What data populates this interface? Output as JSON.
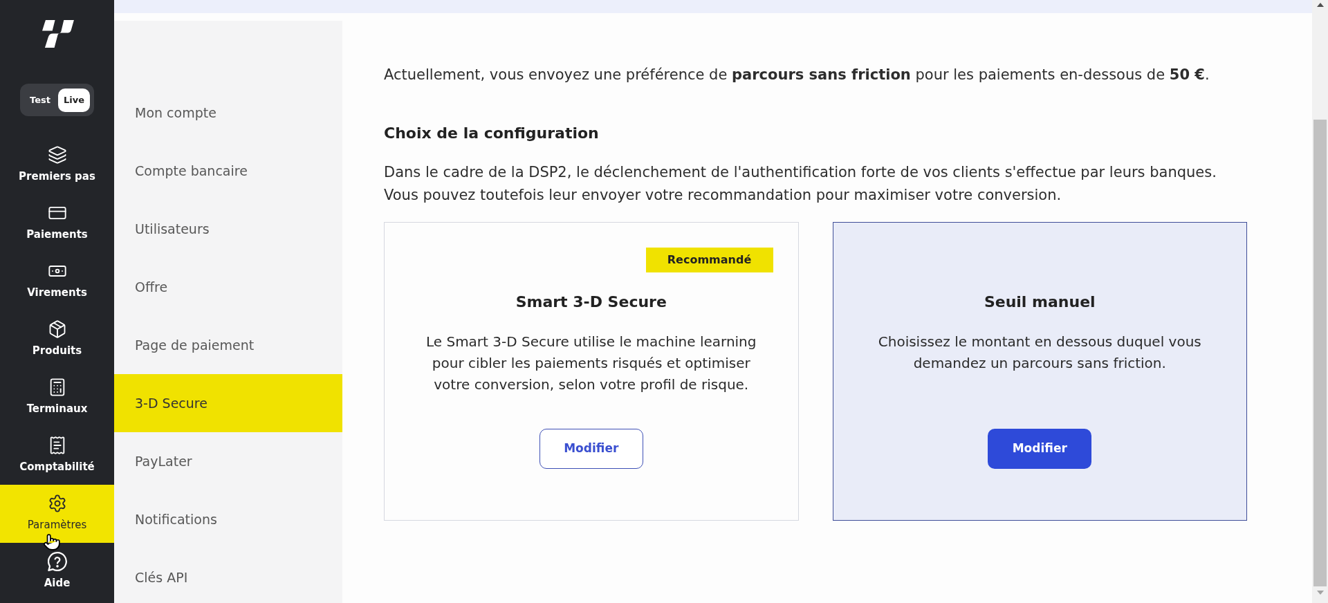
{
  "nav": {
    "mode_toggle": [
      {
        "label": "Test",
        "selected": false
      },
      {
        "label": "Live",
        "selected": true
      }
    ],
    "items": [
      {
        "label": "Premiers pas",
        "selected": false
      },
      {
        "label": "Paiements",
        "selected": false
      },
      {
        "label": "Virements",
        "selected": false
      },
      {
        "label": "Produits",
        "selected": false
      },
      {
        "label": "Terminaux",
        "selected": false
      },
      {
        "label": "Comptabilité",
        "selected": false
      },
      {
        "label": "Paramètres",
        "selected": true
      },
      {
        "label": "Aide",
        "selected": false
      }
    ]
  },
  "settings_menu": {
    "items": [
      {
        "label": "Mon compte",
        "selected": false
      },
      {
        "label": "Compte bancaire",
        "selected": false
      },
      {
        "label": "Utilisateurs",
        "selected": false
      },
      {
        "label": "Offre",
        "selected": false
      },
      {
        "label": "Page de paiement",
        "selected": false
      },
      {
        "label": "3-D Secure",
        "selected": true
      },
      {
        "label": "PayLater",
        "selected": false
      },
      {
        "label": "Notifications",
        "selected": false
      },
      {
        "label": "Clés API",
        "selected": false
      }
    ]
  },
  "content": {
    "summary": "Actuellement, vous envoyez une préférence de **parcours sans friction** pour les paiements en-dessous de **50 €**.",
    "heading": "Choix de la configuration",
    "description": [
      "Dans le cadre de la DSP2, le déclenchement de l'authentification forte de vos clients s'effectue par leurs banques.",
      "Vous pouvez toutefois leur envoyer votre recommandation pour maximiser votre conversion."
    ],
    "options": [
      {
        "badge": "Recommandé",
        "title": "Smart 3-D Secure",
        "description": "Le Smart 3-D Secure utilise le machine learning pour cibler les paiements risqués et optimiser votre conversion, selon votre profil de risque.",
        "button": "Modifier",
        "selected": false
      },
      {
        "title": "Seuil manuel",
        "description": "Choisissez le montant en dessous duquel vous demandez un parcours sans friction.",
        "button": "Modifier",
        "selected": true
      }
    ]
  }
}
